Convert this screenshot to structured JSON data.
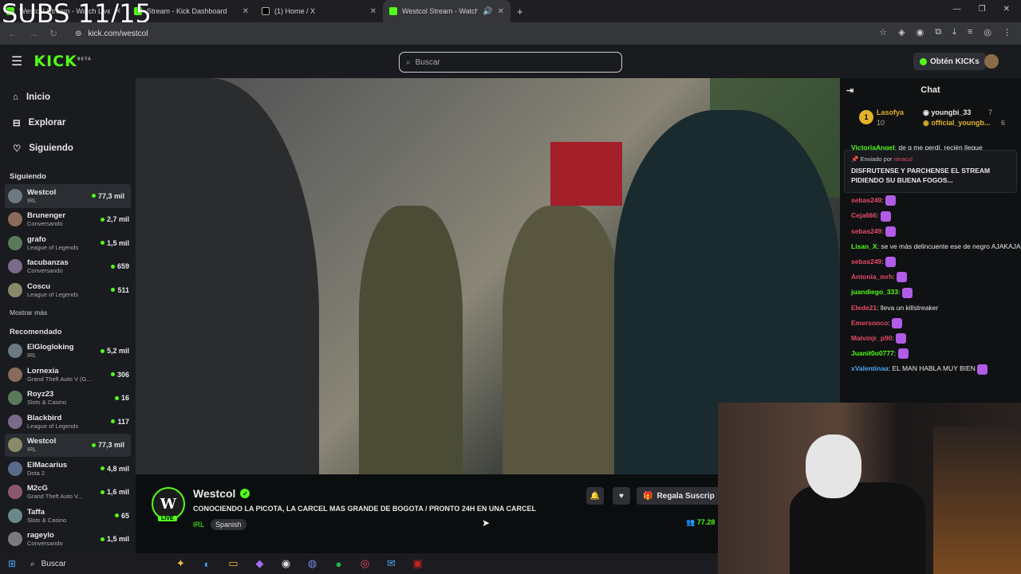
{
  "overlay": {
    "subs_text": "SUBS 11/15"
  },
  "browser": {
    "tabs": [
      {
        "title": "Westcol Stream - Watch Live"
      },
      {
        "title": "Stream - Kick Dashboard"
      },
      {
        "title": "(1) Home / X"
      },
      {
        "title": "Westcol Stream - Watch Liv"
      }
    ],
    "url": "kick.com/westcol"
  },
  "header": {
    "logo": "KICK",
    "logo_sup": "BETA",
    "search_placeholder": "Buscar",
    "kicks_label": "Obtén KICKs"
  },
  "sidebar": {
    "nav": [
      {
        "label": "Inicio",
        "icon": "home-icon"
      },
      {
        "label": "Explorar",
        "icon": "compass-icon"
      },
      {
        "label": "Siguiendo",
        "icon": "heart-icon"
      }
    ],
    "following_title": "Siguiendo",
    "following": [
      {
        "name": "Westcol",
        "category": "IRL",
        "viewers": "77,3 mil"
      },
      {
        "name": "Brunenger",
        "category": "Conversando",
        "viewers": "2,7 mil"
      },
      {
        "name": "grafo",
        "category": "League of Legends",
        "viewers": "1,5 mil"
      },
      {
        "name": "facubanzas",
        "category": "Conversando",
        "viewers": "659"
      },
      {
        "name": "Coscu",
        "category": "League of Legends",
        "viewers": "511"
      }
    ],
    "show_more": "Mostrar más",
    "recommended_title": "Recomendado",
    "recommended": [
      {
        "name": "ElGlogloking",
        "category": "IRL",
        "viewers": "5,2 mil"
      },
      {
        "name": "Lornexia",
        "category": "Grand Theft Auto V (G...",
        "viewers": "306"
      },
      {
        "name": "Royz23",
        "category": "Slots & Casino",
        "viewers": "16"
      },
      {
        "name": "Blackbird",
        "category": "League of Legends",
        "viewers": "117"
      },
      {
        "name": "Westcol",
        "category": "IRL",
        "viewers": "77,3 mil"
      },
      {
        "name": "ElMacarius",
        "category": "Dota 2",
        "viewers": "4,8 mil"
      },
      {
        "name": "M2cG",
        "category": "Grand Theft Auto V...",
        "viewers": "1,6 mil"
      },
      {
        "name": "Taffa",
        "category": "Slots & Casino",
        "viewers": "65"
      },
      {
        "name": "rageylo",
        "category": "Conversando",
        "viewers": "1,5 mil"
      }
    ]
  },
  "stream": {
    "avatar_letter": "W",
    "live_badge": "LIVE",
    "streamer": "Westcol",
    "title": "CONOCIENDO LA PICOTA, LA CARCEL MAS GRANDE DE BOGOTA / PRONTO 24H EN UNA CARCEL",
    "category": "IRL",
    "tag": "Spanish",
    "gift_label": "Regala Suscrip",
    "viewers": "77.28"
  },
  "chat": {
    "title": "Chat",
    "leaderboard": [
      {
        "rank": "1",
        "name": "Lasofya",
        "count": "10"
      },
      {
        "name": "youngbi_33",
        "count": "7"
      },
      {
        "name": "official_youngb...",
        "count": "6"
      }
    ],
    "pinned": {
      "sent_by_label": "Enviado por",
      "sender": "ninacsl",
      "text": "DISFRUTENSE Y PARCHENSE EL STREAM PIDIENDO SU BUENA FOGOS..."
    },
    "top_message": {
      "user": "VictoriaAngel",
      "text": "de q me perdí, recién llegue"
    },
    "messages": [
      {
        "user": "sebas249",
        "text": "",
        "color": "#e84a6a",
        "emote": true
      },
      {
        "user": "Ceja666",
        "text": "",
        "color": "#e84a6a",
        "emote": true
      },
      {
        "user": "sebas249",
        "text": "",
        "color": "#e84a6a",
        "emote": true
      },
      {
        "user": "Lisan_X",
        "text": "se ve más delincuente ese de negro AJAKAJAKAJ",
        "color": "#53fc18",
        "emote": false
      },
      {
        "user": "sebas249",
        "text": "",
        "color": "#e84a6a",
        "emote": true
      },
      {
        "user": "Antonia_mrh",
        "text": "",
        "color": "#e84a6a",
        "emote": true
      },
      {
        "user": "juandiego_333",
        "text": "",
        "color": "#53fc18",
        "emote": true
      },
      {
        "user": "Elede21",
        "text": "lleva un killstreaker",
        "color": "#e84a6a",
        "emote": false
      },
      {
        "user": "Emersonco",
        "text": "",
        "color": "#e84a6a",
        "emote": true
      },
      {
        "user": "Malvinjr_p90",
        "text": "",
        "color": "#e84a6a",
        "emote": true
      },
      {
        "user": "Juanit0o0777",
        "text": "",
        "color": "#53fc18",
        "emote": true
      },
      {
        "user": "xValentinaa",
        "text": "EL MAN HABLA MUY BIEN",
        "color": "#4ea3f0",
        "emote": true
      }
    ]
  },
  "taskbar": {
    "search_label": "Buscar"
  }
}
